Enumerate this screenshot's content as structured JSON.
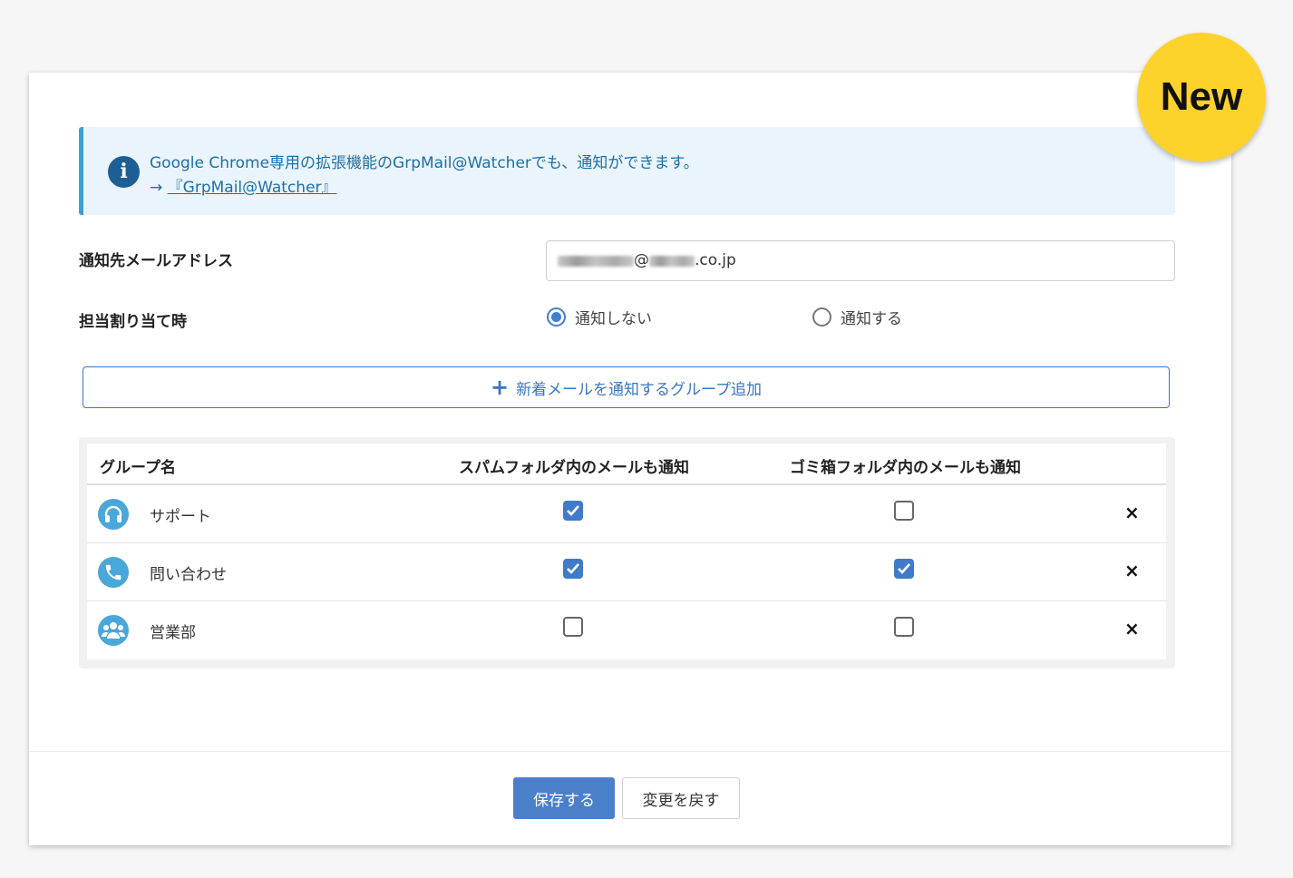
{
  "info": {
    "line1": "Google Chrome専用の拡張機能のGrpMail@Watcherでも、通知ができます。",
    "arrow": "→",
    "link_open": "『",
    "link_text": "GrpMail@Watcher",
    "link_close": "』"
  },
  "email": {
    "label": "通知先メールアドレス",
    "value_visible_at": "@",
    "value_suffix": ".co.jp"
  },
  "assign": {
    "label": "担当割り当て時",
    "options": [
      "通知しない",
      "通知する"
    ],
    "selected": "通知しない"
  },
  "add_group_button": "新着メールを通知するグループ追加",
  "table": {
    "headers": [
      "グループ名",
      "スパムフォルダ内のメールも通知",
      "ゴミ箱フォルダ内のメールも通知"
    ],
    "rows": [
      {
        "name": "サポート",
        "icon": "headset-icon",
        "spam": true,
        "trash": false
      },
      {
        "name": "問い合わせ",
        "icon": "phone-icon",
        "spam": true,
        "trash": true
      },
      {
        "name": "営業部",
        "icon": "people-icon",
        "spam": false,
        "trash": false
      }
    ],
    "delete_glyph": "×"
  },
  "footer": {
    "save": "保存する",
    "revert": "変更を戻す"
  },
  "badge": "New",
  "colors": {
    "accent": "#3f7bc8",
    "info_bg": "#eaf4fc",
    "badge": "#fdd22b"
  }
}
